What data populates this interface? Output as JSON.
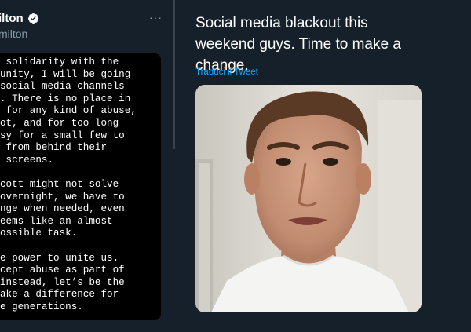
{
  "colors": {
    "background": "#15202b",
    "link": "#1da1f2",
    "muted": "#8899a6",
    "divider": "#38444d"
  },
  "left_tweet": {
    "name": "ilton",
    "handle": "milton",
    "more_icon": "more-horizontal-icon",
    "verified_icon": "verified-badge-icon",
    "note_lines": [
      " solidarity with the",
      "unity, I will be going",
      "social media channels",
      ". There is no place in",
      " for any kind of abuse,",
      "ot, and for too long",
      "sy for a small few to",
      " from behind their",
      " screens.",
      "",
      "cott might not solve",
      "overnight, we have to",
      "nge when needed, even",
      "eems like an almost",
      "ossible task.",
      "",
      "e power to unite us.",
      "cept abuse as part of",
      "instead, let’s be the",
      "ake a difference for",
      "e generations."
    ]
  },
  "right_tweet": {
    "text": "Social media blackout this weekend guys. Time to make a change.",
    "translate_link": "Traduci il Tweet",
    "media_type": "video-thumbnail"
  }
}
